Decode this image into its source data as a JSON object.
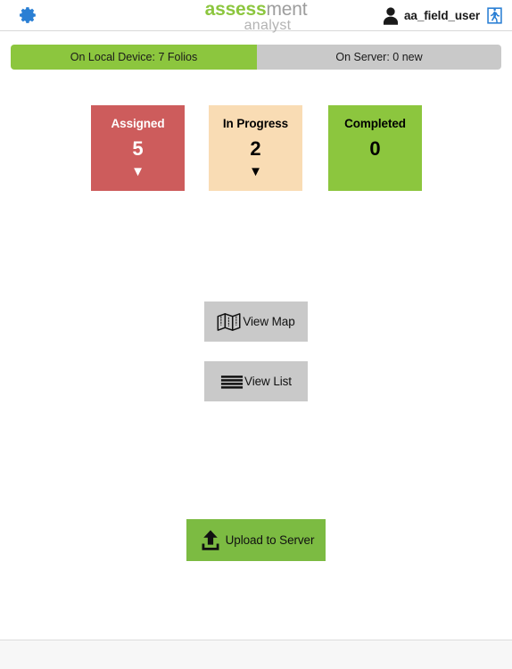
{
  "header": {
    "settings_icon": "gear-icon",
    "logo": {
      "part_bold": "assess",
      "part_light": "ment",
      "subtitle": "analyst"
    },
    "avatar_icon": "user-avatar-icon",
    "username": "aa_field_user",
    "logout_icon": "exit-door-icon"
  },
  "tabs": [
    {
      "label": "On Local Device: 7 Folios",
      "active": true
    },
    {
      "label": "On Server: 0 new",
      "active": false
    }
  ],
  "status_cards": [
    {
      "title": "Assigned",
      "count": "5",
      "caret": "▼"
    },
    {
      "title": "In Progress",
      "count": "2",
      "caret": "▼"
    },
    {
      "title": "Completed",
      "count": "0",
      "caret": ""
    }
  ],
  "actions": {
    "view_map": {
      "label": "View Map",
      "icon": "map-icon"
    },
    "view_list": {
      "label": "View List",
      "icon": "list-icon"
    },
    "upload": {
      "label": "Upload to Server",
      "icon": "upload-icon"
    }
  },
  "colors": {
    "brand_green": "#8cc63e",
    "tab_inactive": "#c9c9c9",
    "card_assigned": "#cd5c5c",
    "card_progress": "#f9dcb4",
    "card_completed": "#8cc63e",
    "upload_green": "#7cbb42",
    "icon_blue": "#2a7fd4"
  }
}
